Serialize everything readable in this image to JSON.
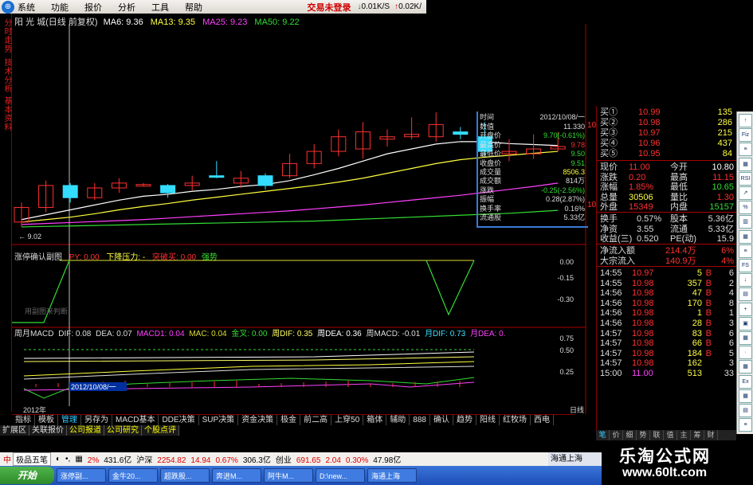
{
  "menu": {
    "items": [
      "系统",
      "功能",
      "报价",
      "分析",
      "工具",
      "帮助"
    ],
    "trade_status": "交易未登录",
    "down_speed": "0.01K/S",
    "up_speed": "0.02K/"
  },
  "left_tabs": [
    "分时走势",
    "技术分析",
    "基本资料"
  ],
  "main_chart": {
    "stock": "阳 光 城(日线 前复权)",
    "ma6_label": "MA6: 9.36",
    "ma13_label": "MA13: 9.35",
    "ma25_label": "MA25: 9.23",
    "ma50_label": "MA50: 9.22",
    "low_marker": "9.02",
    "price_axis": [
      "10",
      "10"
    ]
  },
  "sub1": {
    "title": "涨停确认副图",
    "py": "PY: 0.00",
    "pressure": "下降压力: -",
    "buy": "突破买: 0.00",
    "strong": "强势",
    "watermark": "用副图来判断",
    "axis": [
      "0.00",
      "-0.15",
      "-0.30"
    ]
  },
  "sub2": {
    "legend": [
      {
        "text": "周月MACD",
        "color": "#dddddd"
      },
      {
        "text": "DIF: 0.08",
        "color": "#dddddd"
      },
      {
        "text": "DEA: 0.07",
        "color": "#dddddd"
      },
      {
        "text": "MACD1: 0.04",
        "color": "#ff40ff"
      },
      {
        "text": "MAC: 0.04",
        "color": "#dddd33"
      },
      {
        "text": "金叉: 0.00",
        "color": "#33dd33"
      },
      {
        "text": "周DIF: 0.35",
        "color": "#ffff66"
      },
      {
        "text": "周DEA: 0.36",
        "color": "#ffffff"
      },
      {
        "text": "周MACD: -0.01",
        "color": "#dddddd"
      },
      {
        "text": "月DIF: 0.73",
        "color": "#40e0ff"
      },
      {
        "text": "月DEA: 0.",
        "color": "#ff40ff"
      }
    ],
    "axis": [
      "0.75",
      "0.50",
      "0.25"
    ],
    "date_label": "2012/10/08/一",
    "year_label": "2012年",
    "period": "日线"
  },
  "info_box": {
    "time_label": "时间",
    "time_value": "2012/10/08/一",
    "rows": [
      {
        "label": "数值",
        "value": "11.330",
        "color": "#dddddd"
      },
      {
        "label": "开盘价",
        "value": "9.70(-0.61%)",
        "color": "#33dd33"
      },
      {
        "label": "最高价",
        "value": "9.78",
        "color": "#ff3030"
      },
      {
        "label": "最低价",
        "value": "9.50",
        "color": "#33dd33"
      },
      {
        "label": "收盘价",
        "value": "9.51",
        "color": "#33dd33"
      },
      {
        "label": "成交量",
        "value": "8506.3",
        "color": "#ffff40"
      },
      {
        "label": "成交额",
        "value": "814万",
        "color": "#dddddd"
      },
      {
        "label": "涨跌",
        "value": "-0.25(-2.56%)",
        "color": "#33dd33"
      },
      {
        "label": "振幅",
        "value": "0.28(2.87%)",
        "color": "#dddddd"
      },
      {
        "label": "换手率",
        "value": "0.16%",
        "color": "#dddddd"
      },
      {
        "label": "流通股",
        "value": "5.33亿",
        "color": "#dddddd"
      }
    ]
  },
  "quote": {
    "bids": [
      {
        "label": "买①",
        "price": "10.99",
        "vol": "135"
      },
      {
        "label": "买②",
        "price": "10.98",
        "vol": "286"
      },
      {
        "label": "买③",
        "price": "10.97",
        "vol": "215"
      },
      {
        "label": "买④",
        "price": "10.96",
        "vol": "437"
      },
      {
        "label": "买⑤",
        "price": "10.95",
        "vol": "84"
      }
    ],
    "summary": [
      {
        "l1": "现价",
        "v1": "11.00",
        "c1": "#ff3030",
        "l2": "今开",
        "v2": "10.80",
        "c2": "#ffffff"
      },
      {
        "l1": "涨跌",
        "v1": "0.20",
        "c1": "#ff3030",
        "l2": "最高",
        "v2": "11.15",
        "c2": "#ff3030"
      },
      {
        "l1": "涨幅",
        "v1": "1.85%",
        "c1": "#ff3030",
        "l2": "最低",
        "v2": "10.65",
        "c2": "#33dd33"
      },
      {
        "l1": "总量",
        "v1": "30506",
        "c1": "#ffff40",
        "l2": "量比",
        "v2": "1.30",
        "c2": "#ff3030"
      },
      {
        "l1": "外盘",
        "v1": "15349",
        "c1": "#ff3030",
        "l2": "内盘",
        "v2": "15157",
        "c2": "#33dd33"
      }
    ],
    "fund": [
      {
        "l1": "换手",
        "v1": "0.57%",
        "l2": "股本",
        "v2": "5.36亿"
      },
      {
        "l1": "净资",
        "v1": "3.55",
        "l2": "流通",
        "v2": "5.33亿"
      },
      {
        "l1": "收益(三)",
        "v1": "0.520",
        "l2": "PE(动)",
        "v2": "15.9"
      }
    ],
    "flow": [
      {
        "label": "净流入额",
        "value": "214.4万",
        "pct": "6%"
      },
      {
        "label": "大宗流入",
        "value": "140.9万",
        "pct": "4%"
      }
    ],
    "ticks": [
      {
        "time": "14:55",
        "price": "10.97",
        "vol": "5",
        "dir": "B",
        "c": "#ff3030"
      },
      {
        "time": "14:55",
        "price": "10.98",
        "vol": "357",
        "dir": "B",
        "c": "#ff3030"
      },
      {
        "time": "14:56",
        "price": "10.98",
        "vol": "47",
        "dir": "B",
        "c": "#ff3030"
      },
      {
        "time": "14:56",
        "price": "10.98",
        "vol": "170",
        "dir": "B",
        "c": "#ff3030"
      },
      {
        "time": "14:56",
        "price": "10.98",
        "vol": "1",
        "dir": "B",
        "c": "#ff3030"
      },
      {
        "time": "14:56",
        "price": "10.98",
        "vol": "28",
        "dir": "B",
        "c": "#ff3030"
      },
      {
        "time": "14:57",
        "price": "10.98",
        "vol": "83",
        "dir": "B",
        "c": "#ff3030"
      },
      {
        "time": "14:57",
        "price": "10.98",
        "vol": "66",
        "dir": "B",
        "c": "#ff3030"
      },
      {
        "time": "14:57",
        "price": "10.98",
        "vol": "184",
        "dir": "B",
        "c": "#ff3030"
      },
      {
        "time": "14:57",
        "price": "10.98",
        "vol": "162",
        "dir": "",
        "c": "#ff3030"
      },
      {
        "time": "15:00",
        "price": "11.00",
        "vol": "513",
        "dir": "",
        "c": "#ff40ff"
      }
    ],
    "tick_side": [
      "6",
      "2",
      "4",
      "8",
      "1",
      "3",
      "6",
      "6",
      "5",
      "3",
      "33"
    ]
  },
  "quote_tabs": [
    "笔",
    "价",
    "细",
    "势",
    "联",
    "值",
    "主",
    "筹",
    "财"
  ],
  "right_tools": [
    "↑",
    "Fiz",
    "≡",
    "▦",
    "RSI",
    "↗",
    "%",
    "▥",
    "▦",
    "≡",
    "FS",
    "↓",
    "▤",
    "+",
    "▣",
    "▦",
    "·",
    "▦",
    "Ex",
    "▦",
    "▤",
    "≡"
  ],
  "bottom_tabs": [
    "指标",
    "模板",
    "管理",
    "另存为",
    "MACD基本",
    "DDE决策",
    "SUP决策",
    "资金决策",
    "极金",
    "前二高",
    "上穿50",
    "箱体",
    "辅助",
    "888",
    "确认",
    "趋势",
    "阳线",
    "红牧场",
    "西电"
  ],
  "sub_tabs": [
    "扩展区",
    "关联报价",
    "公司报道",
    "公司研究",
    "个股点评"
  ],
  "ticker": {
    "app": "极品五笔",
    "items": [
      {
        "text": "2%",
        "c": "red"
      },
      {
        "text": "431.6亿",
        "c": ""
      },
      {
        "text": "沪深",
        "c": ""
      },
      {
        "text": "2254.82",
        "c": "red"
      },
      {
        "text": "14.94",
        "c": "red"
      },
      {
        "text": "0.67%",
        "c": "red"
      },
      {
        "text": "306.3亿",
        "c": ""
      },
      {
        "text": "创业",
        "c": ""
      },
      {
        "text": "691.65",
        "c": "red"
      },
      {
        "text": "2.04",
        "c": "red"
      },
      {
        "text": "0.30%",
        "c": "red"
      },
      {
        "text": "47.98亿",
        "c": ""
      }
    ],
    "hq": "海通上海"
  },
  "taskbar": {
    "start": "开始",
    "tasks": [
      "涨停副...",
      "金牛20...",
      "超跌股...",
      "奔进M...",
      "阿牛M...",
      "D:\\new...",
      "海通上海"
    ]
  },
  "watermark": {
    "title": "乐淘公式网",
    "url": "www.60lt.com"
  },
  "colors": {
    "up": "#ff3030",
    "down": "#33dd33",
    "cyan": "#33ddff",
    "yellow": "#ffff40",
    "magenta": "#ff40ff"
  },
  "chart_data": {
    "type": "line",
    "candles": [
      {
        "o": 9.05,
        "c": 9.35,
        "h": 9.45,
        "l": 8.95,
        "up": true
      },
      {
        "o": 9.35,
        "c": 9.8,
        "h": 9.9,
        "l": 9.25,
        "up": true
      },
      {
        "o": 9.8,
        "c": 9.55,
        "h": 9.85,
        "l": 9.45,
        "up": false
      },
      {
        "o": 9.55,
        "c": 9.75,
        "h": 9.85,
        "l": 9.5,
        "up": true
      },
      {
        "o": 9.75,
        "c": 9.85,
        "h": 9.95,
        "l": 9.65,
        "up": true
      },
      {
        "o": 9.82,
        "c": 9.82,
        "h": 9.85,
        "l": 9.78,
        "up": true
      },
      {
        "o": 9.8,
        "c": 9.65,
        "h": 9.83,
        "l": 9.55,
        "up": false
      },
      {
        "o": 9.8,
        "c": 9.85,
        "h": 10.0,
        "l": 9.7,
        "up": true
      },
      {
        "o": 10.0,
        "c": 10.0,
        "h": 10.3,
        "l": 9.95,
        "up": false
      },
      {
        "o": 9.85,
        "c": 9.95,
        "h": 10.1,
        "l": 9.75,
        "up": true
      },
      {
        "o": 10.0,
        "c": 9.8,
        "h": 10.05,
        "l": 9.72,
        "up": false
      },
      {
        "o": 10.0,
        "c": 10.25,
        "h": 10.45,
        "l": 9.95,
        "up": true
      },
      {
        "o": 10.25,
        "c": 10.5,
        "h": 10.65,
        "l": 10.15,
        "up": true
      },
      {
        "o": 10.5,
        "c": 10.8,
        "h": 10.95,
        "l": 10.4,
        "up": true
      },
      {
        "o": 10.55,
        "c": 10.9,
        "h": 11.1,
        "l": 10.35,
        "up": true
      },
      {
        "o": 10.8,
        "c": 10.75,
        "h": 10.95,
        "l": 10.6,
        "up": true
      },
      {
        "o": 10.8,
        "c": 10.85,
        "h": 11.2,
        "l": 10.75,
        "up": true
      },
      {
        "o": 10.8,
        "c": 11.05,
        "h": 11.3,
        "l": 10.7,
        "up": true
      },
      {
        "o": 10.9,
        "c": 10.85,
        "h": 11.0,
        "l": 10.75,
        "up": false
      },
      {
        "o": 10.8,
        "c": 10.5,
        "h": 11.1,
        "l": 10.4,
        "up": false
      },
      {
        "o": 10.45,
        "c": 10.5,
        "h": 10.75,
        "l": 10.3,
        "up": true
      },
      {
        "o": 10.45,
        "c": 10.55,
        "h": 10.85,
        "l": 10.35,
        "up": true
      },
      {
        "o": 10.55,
        "c": 10.6,
        "h": 10.9,
        "l": 10.5,
        "up": true
      }
    ],
    "ma6": [
      9.1,
      9.2,
      9.3,
      9.4,
      9.5,
      9.58,
      9.62,
      9.68,
      9.72,
      9.78,
      9.82,
      9.9,
      10.02,
      10.15,
      10.3,
      10.45,
      10.55,
      10.65,
      10.7,
      10.7,
      10.66,
      10.64,
      10.62
    ],
    "ma13": [
      9.05,
      9.1,
      9.15,
      9.22,
      9.3,
      9.37,
      9.43,
      9.5,
      9.56,
      9.62,
      9.68,
      9.74,
      9.8,
      9.87,
      9.95,
      10.05,
      10.15,
      10.25,
      10.33,
      10.38,
      10.42,
      10.46,
      10.5
    ],
    "ma25": [
      9.0,
      9.02,
      9.04,
      9.06,
      9.08,
      9.1,
      9.13,
      9.16,
      9.19,
      9.22,
      9.25,
      9.28,
      9.32,
      9.36,
      9.4,
      9.45,
      9.5,
      9.55,
      9.6,
      9.66,
      9.72,
      9.78,
      9.85
    ],
    "ma50": [
      8.95,
      8.96,
      8.97,
      8.98,
      8.99,
      9.0,
      9.01,
      9.02,
      9.03,
      9.04,
      9.05,
      9.06,
      9.07,
      9.09,
      9.11,
      9.13,
      9.15,
      9.17,
      9.19,
      9.21,
      9.23,
      9.26,
      9.29
    ],
    "ylim": [
      8.9,
      11.4
    ]
  }
}
